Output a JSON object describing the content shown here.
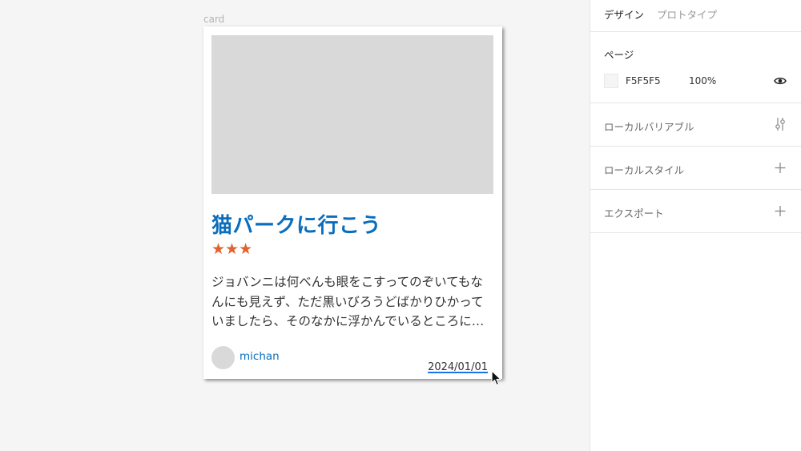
{
  "canvas": {
    "frame_label": "card",
    "card": {
      "title": "猫パークに行こう",
      "stars": "★★★",
      "rating": 3,
      "body": "ジョバンニは何べんも眼をこすってのぞいてもなんにも見えず、ただ黒いびろうどばかりひかっていましたら、そのなかに浮かんでいるところに…",
      "author": "michan",
      "date": "2024/01/01"
    }
  },
  "panel": {
    "tabs": [
      {
        "label": "デザイン",
        "active": true
      },
      {
        "label": "プロトタイプ",
        "active": false
      }
    ],
    "page": {
      "title": "ページ",
      "fill_hex": "F5F5F5",
      "fill_opacity": "100%",
      "visibility_icon": "eye-icon"
    },
    "rows": [
      {
        "label": "ローカルバリアブル",
        "icon": "sliders-icon"
      },
      {
        "label": "ローカルスタイル",
        "icon": "plus-icon"
      },
      {
        "label": "エクスポート",
        "icon": "plus-icon"
      }
    ]
  },
  "colors": {
    "canvas_bg": "#F5F5F5",
    "title": "#0A6EBD",
    "stars": "#E0622C",
    "placeholder": "#D9D9D9"
  }
}
